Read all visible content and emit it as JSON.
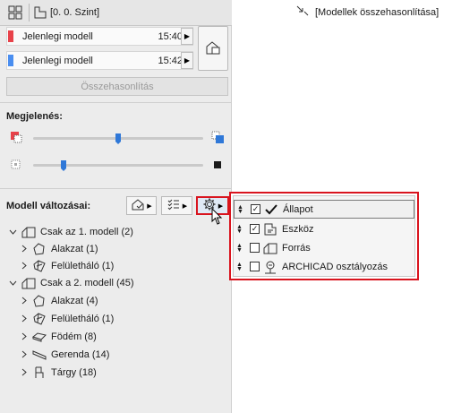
{
  "tabs": {
    "left_label": "[0. 0. Szint]",
    "right_label": "[Modellek összehasonlítása]"
  },
  "models": [
    {
      "name": "Jelenlegi modell",
      "time": "15:40",
      "color": "#e8424a"
    },
    {
      "name": "Jelenlegi modell",
      "time": "15:42",
      "color": "#4a8ef0"
    }
  ],
  "compare_button": "Összehasonlítás",
  "appearance": {
    "label": "Megjelenés:",
    "slider1_value": 0.5,
    "slider2_value": 0.2
  },
  "changes": {
    "label": "Modell változásai:"
  },
  "tree": [
    {
      "level": 0,
      "label": "Csak az 1. modell (2)",
      "icon": "house-icon",
      "expanded": true
    },
    {
      "level": 1,
      "label": "Alakzat (1)",
      "icon": "morph-icon",
      "expanded": false
    },
    {
      "level": 1,
      "label": "Felületháló (1)",
      "icon": "mesh-icon",
      "expanded": false
    },
    {
      "level": 0,
      "label": "Csak a 2. modell (45)",
      "icon": "house-icon",
      "expanded": true
    },
    {
      "level": 1,
      "label": "Alakzat (4)",
      "icon": "morph-icon",
      "expanded": false
    },
    {
      "level": 1,
      "label": "Felületháló (1)",
      "icon": "mesh-icon",
      "expanded": false
    },
    {
      "level": 1,
      "label": "Födém (8)",
      "icon": "slab-icon",
      "expanded": false
    },
    {
      "level": 1,
      "label": "Gerenda (14)",
      "icon": "beam-icon",
      "expanded": false
    },
    {
      "level": 1,
      "label": "Tárgy (18)",
      "icon": "object-icon",
      "expanded": false
    }
  ],
  "dropdown": [
    {
      "label": "Állapot",
      "checked": true,
      "icon": "checkmark-icon"
    },
    {
      "label": "Eszköz",
      "checked": true,
      "icon": "tool-icon"
    },
    {
      "label": "Forrás",
      "checked": false,
      "icon": "house-icon"
    },
    {
      "label": "ARCHICAD osztályozás",
      "checked": false,
      "icon": "classification-icon"
    }
  ],
  "accent": "#2f78d8",
  "highlight": "#d9141e"
}
